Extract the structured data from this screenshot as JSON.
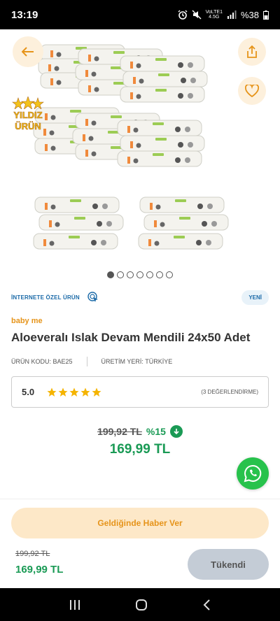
{
  "status_bar": {
    "time": "13:19",
    "network_top": "VoLTE1",
    "network_type": "4.5G",
    "battery": "%38"
  },
  "gallery": {
    "badge_line1": "YILDIZ",
    "badge_line2": "ÜRÜN",
    "total_images": 7,
    "active_index": 0
  },
  "product": {
    "internet_label": "İNTERNETE ÖZEL ÜRÜN",
    "new_badge": "YENİ",
    "brand": "baby me",
    "title": "Aloeveralı Islak Devam Mendili 24x50 Adet",
    "code": "ÜRÜN KODU: BAE25",
    "origin": "ÜRETİM YERİ: TÜRKİYE",
    "rating": "5.0",
    "star_count": 5,
    "rating_count": "(3 DEĞERLENDİRME)",
    "old_price": "199,92 TL",
    "discount": "%15",
    "new_price": "169,99 TL"
  },
  "footer": {
    "notify_button": "Geldiğinde Haber Ver",
    "old_price": "199,92 TL",
    "new_price": "169,99 TL",
    "sold_out_button": "Tükendi"
  },
  "colors": {
    "accent_orange": "#e6941a",
    "price_green": "#1a9a55",
    "link_blue": "#1b6aa8",
    "whatsapp_green": "#27c24c"
  }
}
